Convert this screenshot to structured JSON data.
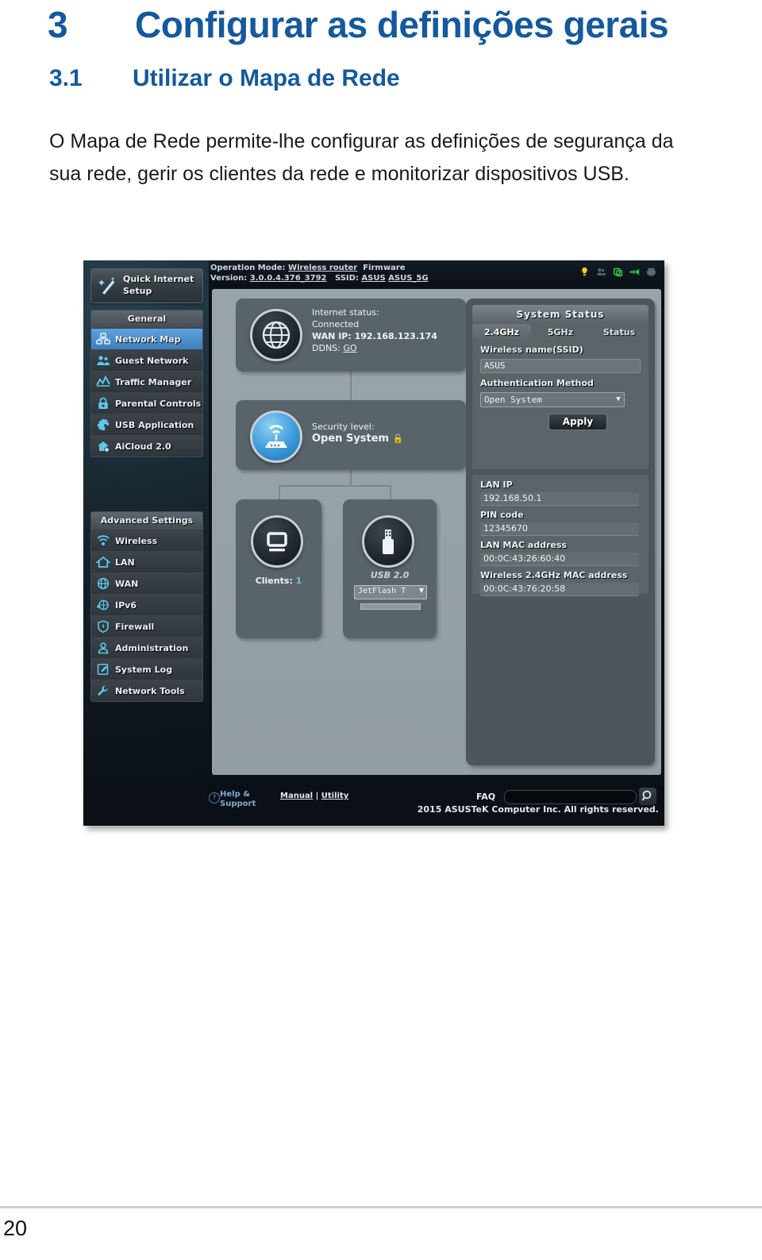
{
  "document": {
    "chapter_number": "3",
    "chapter_title": "Configurar as definições gerais",
    "section_number": "3.1",
    "section_title": "Utilizar o Mapa de Rede",
    "paragraph": "O Mapa de Rede permite-lhe configurar as definições de segurança da sua rede, gerir os clientes da rede e monitorizar dispositivos USB.",
    "page_number": "20",
    "heading_color": "#14599e"
  },
  "router_ui": {
    "topbar": {
      "line1": "Operation Mode: Wireless router  Firmware",
      "operation_mode_label": "Operation Mode:",
      "operation_mode_value": "Wireless router",
      "firmware_label": "Firmware",
      "version_label": "Version:",
      "version_value": "3.0.0.4.376_3792",
      "ssid_label": "SSID:",
      "ssid_value_1": "ASUS",
      "ssid_value_2": "ASUS_5G",
      "tray_icons": [
        "bulb-icon",
        "guest-network-icon",
        "router-status-icon",
        "usb-icon",
        "printer-icon"
      ]
    },
    "sidebar": {
      "quick_setup": "Quick Internet Setup",
      "quick_setup_icon": "wand-icon",
      "groups": [
        {
          "title": "General",
          "items": [
            {
              "label": "Network Map",
              "icon": "network-map-icon",
              "selected": true
            },
            {
              "label": "Guest Network",
              "icon": "guest-network-icon",
              "selected": false
            },
            {
              "label": "Traffic Manager",
              "icon": "traffic-chart-icon",
              "selected": false
            },
            {
              "label": "Parental Controls",
              "icon": "lock-icon",
              "selected": false
            },
            {
              "label": "USB Application",
              "icon": "puzzle-icon",
              "selected": false
            },
            {
              "label": "AiCloud 2.0",
              "icon": "cloud-home-icon",
              "selected": false
            }
          ]
        },
        {
          "title": "Advanced Settings",
          "items": [
            {
              "label": "Wireless",
              "icon": "wifi-icon",
              "selected": false
            },
            {
              "label": "LAN",
              "icon": "home-icon",
              "selected": false
            },
            {
              "label": "WAN",
              "icon": "globe-icon",
              "selected": false
            },
            {
              "label": "IPv6",
              "icon": "ipv6-globe-icon",
              "selected": false
            },
            {
              "label": "Firewall",
              "icon": "shield-icon",
              "selected": false
            },
            {
              "label": "Administration",
              "icon": "user-icon",
              "selected": false
            },
            {
              "label": "System Log",
              "icon": "pencil-note-icon",
              "selected": false
            },
            {
              "label": "Network Tools",
              "icon": "wrench-icon",
              "selected": false
            }
          ]
        }
      ]
    },
    "map": {
      "internet": {
        "icon": "globe-icon",
        "status_label": "Internet status:",
        "status_value": "Connected",
        "wan_ip": "WAN IP: 192.168.123.174",
        "ddns_label": "DDNS:",
        "ddns_link": "GO"
      },
      "security": {
        "icon": "router-icon",
        "label": "Security level:",
        "value": "Open System",
        "badge_icon": "unlock-icon"
      },
      "clients": {
        "icon": "monitor-icon",
        "label": "Clients:",
        "count": "1"
      },
      "usb": {
        "icon": "usb-stick-icon",
        "title": "USB 2.0",
        "device": "JetFlash T",
        "dropdown_icon": "chevron-down-icon"
      }
    },
    "system_status": {
      "title": "System Status",
      "tabs": [
        {
          "label": "2.4GHz",
          "active": true
        },
        {
          "label": "5GHz",
          "active": false
        },
        {
          "label": "Status",
          "active": false
        }
      ],
      "ssid_label": "Wireless name(SSID)",
      "ssid_value": "ASUS",
      "auth_label": "Authentication Method",
      "auth_value": "Open System",
      "apply_label": "Apply",
      "fields": [
        {
          "label": "LAN IP",
          "value": "192.168.50.1"
        },
        {
          "label": "PIN code",
          "value": "12345670"
        },
        {
          "label": "LAN MAC address",
          "value": "00:0C:43:26:60:40"
        },
        {
          "label": "Wireless 2.4GHz MAC address",
          "value": "00:0C:43:76:20:58"
        }
      ]
    },
    "footer": {
      "help_line1": "Help &",
      "help_line2": "Support",
      "help_icon": "question-icon",
      "manual": "Manual",
      "separator": "|",
      "utility": "Utility",
      "faq_label": "FAQ",
      "search_icon": "magnifier-icon",
      "copyright": "2015 ASUSTeK Computer Inc. All rights reserved."
    }
  }
}
